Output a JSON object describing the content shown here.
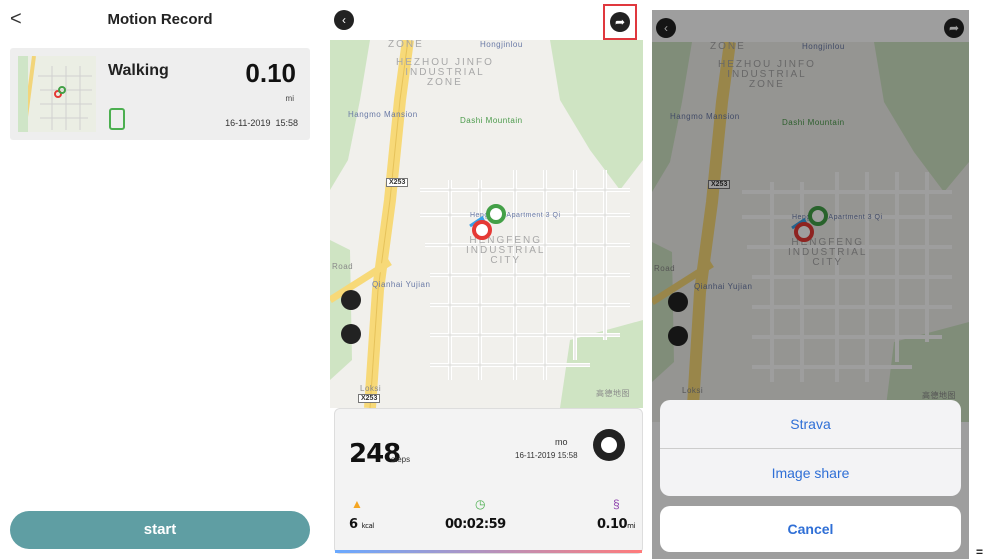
{
  "panel1": {
    "title": "Motion Record",
    "back_glyph": "<",
    "record": {
      "activity": "Walking",
      "distance": "0.10",
      "unit": "mi",
      "date": "16-11-2019",
      "time": "15:58",
      "device_icon": "phone-icon"
    },
    "start_label": "start"
  },
  "map": {
    "labels": {
      "zone_top": "ZONE",
      "hongjinlou": "Hongjinlou",
      "hezhou": "HEZHOU JINFO\nINDUSTRIAL\nZONE",
      "hangmo": "Hangmo Mansion",
      "dashi": "Dashi Mountain",
      "x253": "X253",
      "apartment": "Hengfeng Apartment 3 Qi",
      "hengfeng": "HENGFENG\nINDUSTRIAL\nCITY",
      "road": "Road",
      "qianhai": "Qianhai Yujian",
      "loksi": "Loksi",
      "gaode": "高德地图"
    }
  },
  "panel2": {
    "steps": "248",
    "steps_unit": "steps",
    "user": "mo",
    "datetime": "16-11-2019 15:58",
    "calories": "6",
    "calories_unit": "kcal",
    "duration": "00:02:59",
    "distance": "0.10",
    "distance_unit": "mi",
    "colors": {
      "calorie": "#f5a623",
      "timer": "#4caf50",
      "distance": "#8e44ad",
      "highlight": "#e0383e"
    }
  },
  "panel3": {
    "options": [
      "Strava",
      "Image share"
    ],
    "cancel": "Cancel"
  },
  "trailing_mark": "="
}
